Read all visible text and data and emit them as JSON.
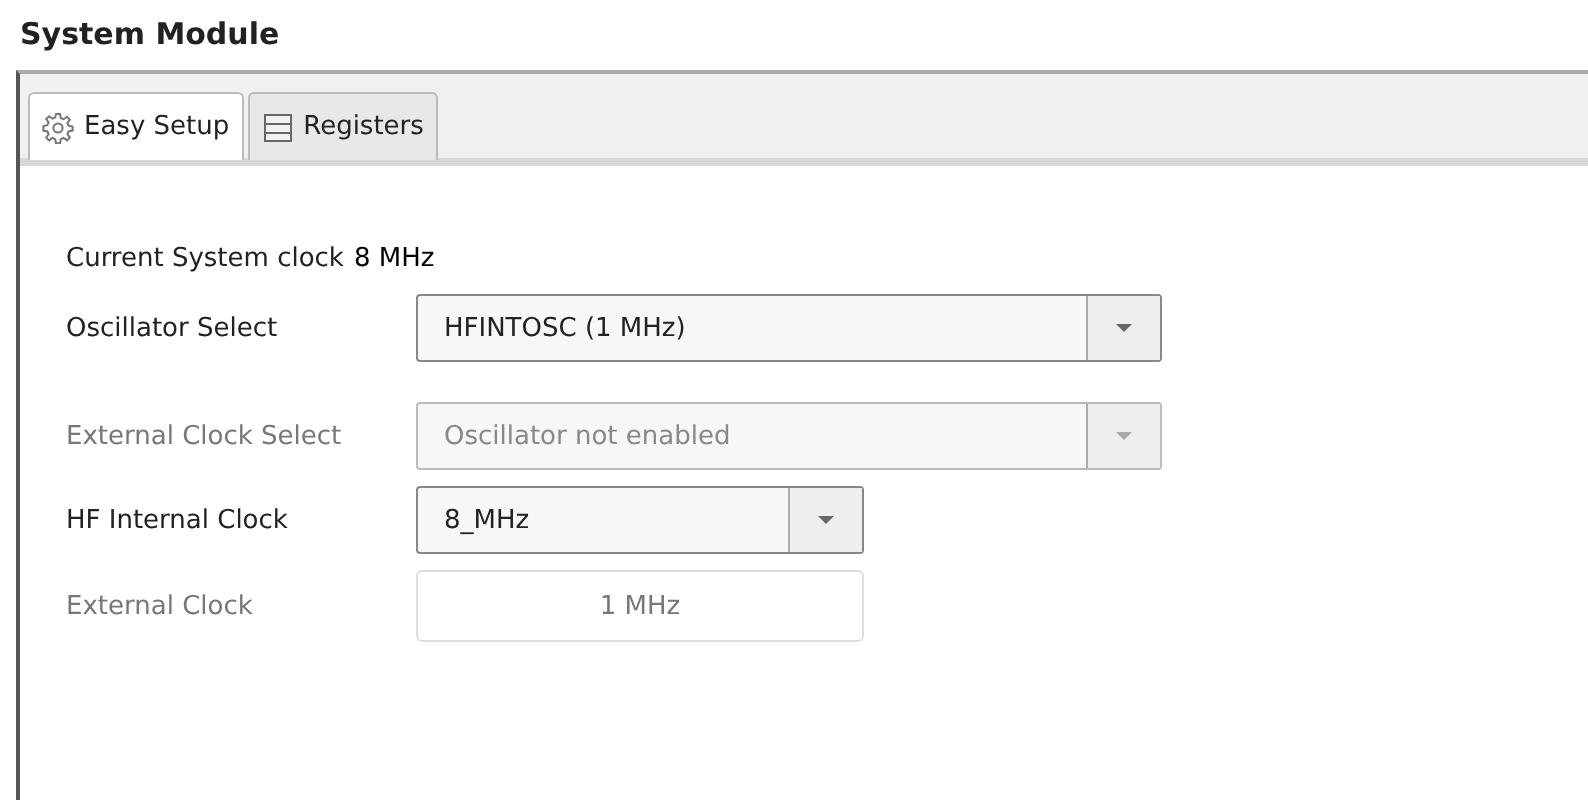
{
  "title": "System Module",
  "tabs": [
    {
      "label": "Easy Setup",
      "selected": true
    },
    {
      "label": "Registers",
      "selected": false
    }
  ],
  "rows": [
    {
      "kind": "reading",
      "label": "Current System clock",
      "value": "8 MHz"
    },
    {
      "kind": "select",
      "label": "Oscillator Select",
      "value": "HFINTOSC (1 MHz)",
      "disabled": false
    },
    {
      "kind": "select",
      "label": "External Clock Select",
      "value": "Oscillator not enabled",
      "disabled": true
    },
    {
      "kind": "select",
      "label": "HF Internal Clock",
      "value": "8_MHz",
      "disabled": false
    },
    {
      "kind": "textbox",
      "label": "External Clock",
      "value": "1 MHz",
      "disabled": true
    }
  ]
}
